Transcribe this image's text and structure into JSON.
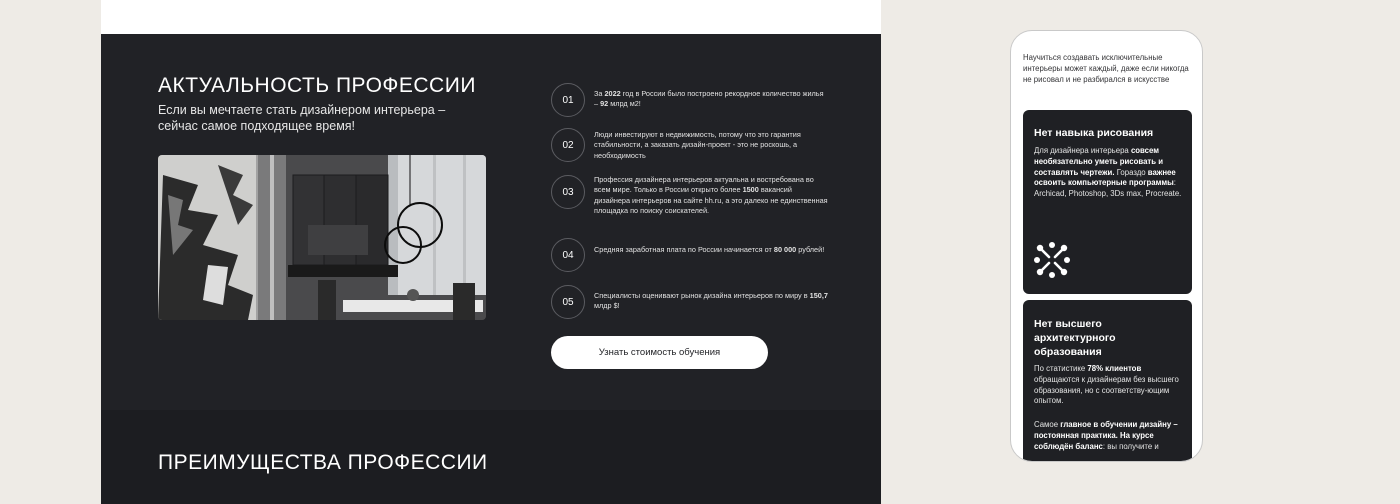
{
  "desktop": {
    "relevance_title": "АКТУАЛЬНОСТЬ ПРОФЕССИИ",
    "relevance_subtitle": "Если вы мечтаете стать дизайнером интерьера – сейчас самое подходящее время!",
    "facts": [
      {
        "num": "01",
        "parts": [
          {
            "t": "За "
          },
          {
            "t": "2022",
            "b": true
          },
          {
            "t": " год в России было построено рекордное количество жилья – "
          },
          {
            "t": "92",
            "b": true
          },
          {
            "t": " млрд м2!"
          }
        ]
      },
      {
        "num": "02",
        "parts": [
          {
            "t": "Люди инвестируют в недвижимость, потому что это гарантия стабильности, а заказать  дизайн-проект - это не роскошь, а необходимость"
          }
        ]
      },
      {
        "num": "03",
        "parts": [
          {
            "t": "Профессия дизайнера интерьеров актуальна и востребована во всем мире. Только в России открыто более "
          },
          {
            "t": "1500",
            "b": true
          },
          {
            "t": " вакансий дизайнера интерьеров на сайте hh.ru, а это далеко не единственная площадка по поиску соискателей."
          }
        ]
      },
      {
        "num": "04",
        "parts": [
          {
            "t": "Средняя заработная плата по России начинается от "
          },
          {
            "t": "80 000",
            "b": true
          },
          {
            "t": " рублей!"
          }
        ]
      },
      {
        "num": "05",
        "parts": [
          {
            "t": "Специалисты оценивают рынок дизайна интерьеров по миру в "
          },
          {
            "t": "150,7",
            "b": true
          },
          {
            "t": " млдр $!"
          }
        ]
      }
    ],
    "cta_label": "Узнать стоимость обучения",
    "advantages_title": "ПРЕИМУЩЕСТВА ПРОФЕССИИ"
  },
  "mobile": {
    "intro": "Научиться создавать исключительные интерьеры может каждый, даже если никогда не рисовал и не разбирался в искусстве",
    "cards": [
      {
        "title": "Нет навыка рисования",
        "icon": "plugin-icon",
        "parts": [
          {
            "t": "Для дизайнера интерьера "
          },
          {
            "t": "совсем необязательно уметь рисовать и составлять чертежи.",
            "b": true
          },
          {
            "t": " Гораздо "
          },
          {
            "t": "важнее освоить компьютерные программы",
            "b": true
          },
          {
            "t": ": Archicad, Photoshop, 3Ds max, Procreate."
          }
        ]
      },
      {
        "title": "Нет высшего архитектурного образования",
        "parts": [
          {
            "t": "По статистике "
          },
          {
            "t": "78% клиентов",
            "b": true
          },
          {
            "t": " обращаются к дизайнерам без высшего образования, но с соответству-ющим опытом."
          }
        ],
        "parts2": [
          {
            "t": "Самое "
          },
          {
            "t": "главное в обучении дизайну – постоянная практика. На курсе соблюдён баланс",
            "b": true
          },
          {
            "t": ": вы получите и"
          }
        ]
      }
    ]
  },
  "colors": {
    "page_bg": "#eeebe6",
    "dark_section": "#212226",
    "card_bg": "#1f2024",
    "accent_white": "#ffffff"
  }
}
